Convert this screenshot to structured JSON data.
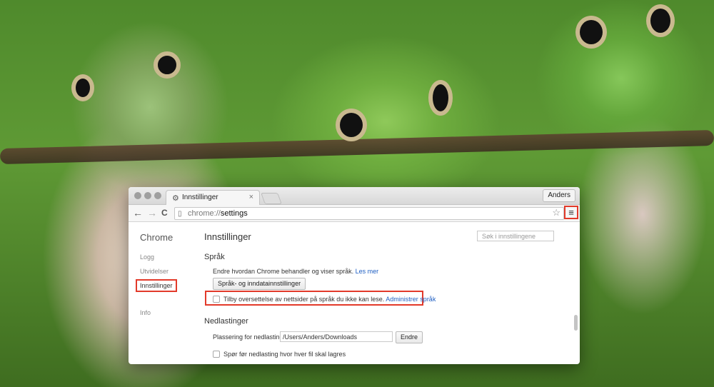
{
  "window": {
    "tab_title": "Innstillinger",
    "tab_close": "×",
    "profile_name": "Anders",
    "colors": {
      "highlight": "#e23a2a",
      "link": "#1e5ec2"
    }
  },
  "toolbar": {
    "back": "←",
    "forward": "→",
    "reload": "C",
    "url_scheme": "chrome://",
    "url_path": "settings",
    "star": "☆",
    "menu": "≡"
  },
  "sidebar": {
    "title": "Chrome",
    "items": [
      {
        "label": "Logg"
      },
      {
        "label": "Utvidelser"
      },
      {
        "label": "Innstillinger",
        "active": true
      },
      {
        "label": "Info"
      }
    ]
  },
  "main": {
    "title": "Innstillinger",
    "search_placeholder": "Søk i innstillingene",
    "language": {
      "heading": "Språk",
      "description": "Endre hvordan Chrome behandler og viser språk.",
      "learn_more": "Les mer",
      "settings_button": "Språk- og inndatainnstillinger",
      "translate_checkbox_label": "Tilby oversettelse av nettsider på språk du ikke kan lese.",
      "translate_checked": false,
      "manage_languages": "Administrer språk"
    },
    "downloads": {
      "heading": "Nedlastinger",
      "location_label": "Plassering for nedlasting:",
      "location_value": "/Users/Anders/Downloads",
      "change_button": "Endre",
      "ask_checkbox_label": "Spør før nedlasting hvor hver fil skal lagres",
      "ask_checked": false
    }
  }
}
